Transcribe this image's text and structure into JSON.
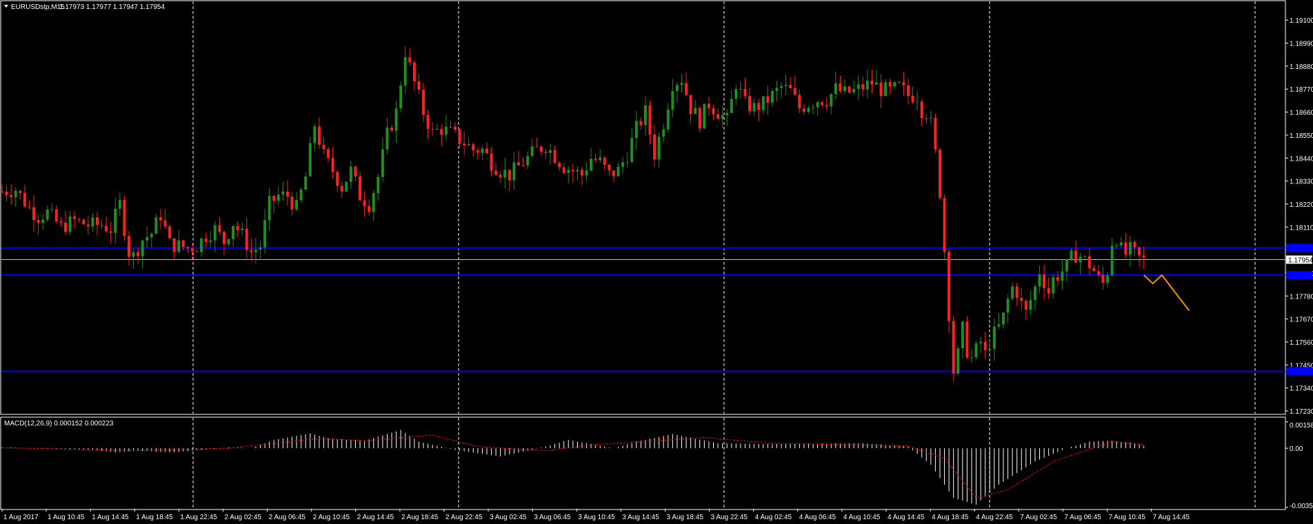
{
  "window": {
    "symbol_title": "EURUSDstp,M15",
    "ohlc": "1.17973 1.17977 1.17947 1.17954"
  },
  "colors": {
    "background": "#000000",
    "grid": "#ffffff",
    "bull_candle": "#1f8f1f",
    "bear_candle": "#ff2020",
    "level_line": "#0000ff",
    "bid_line": "#c0c0c0",
    "forecast_line": "#ff8c00",
    "macd_hist": "#ffffff",
    "macd_signal": "#ff0000"
  },
  "chart_data": [
    {
      "type": "candlestick",
      "title": "EURUSDstp,M15",
      "ylim": [
        1.1723,
        1.1917
      ],
      "y_ticks": [
        "1.19100",
        "1.18990",
        "1.18880",
        "1.18770",
        "1.18660",
        "1.18550",
        "1.18440",
        "1.18330",
        "1.18220",
        "1.18110",
        "1.17890",
        "1.17780",
        "1.17670",
        "1.17560",
        "1.17450",
        "1.17340",
        "1.17230"
      ],
      "x_ticks": [
        "1 Aug 2017",
        "1 Aug 10:45",
        "1 Aug 14:45",
        "1 Aug 18:45",
        "1 Aug 22:45",
        "2 Aug 02:45",
        "2 Aug 06:45",
        "2 Aug 10:45",
        "2 Aug 14:45",
        "2 Aug 18:45",
        "2 Aug 22:45",
        "3 Aug 02:45",
        "3 Aug 06:45",
        "3 Aug 10:45",
        "3 Aug 14:45",
        "3 Aug 18:45",
        "3 Aug 22:45",
        "4 Aug 02:45",
        "4 Aug 06:45",
        "4 Aug 10:45",
        "4 Aug 14:45",
        "4 Aug 18:45",
        "4 Aug 22:45",
        "7 Aug 02:45",
        "7 Aug 06:45",
        "7 Aug 10:45",
        "7 Aug 14:45"
      ],
      "current_price": "1.17954",
      "horizontal_levels": [
        1.1801,
        1.1788,
        1.1742
      ],
      "close_path": [
        [
          0,
          1.1828
        ],
        [
          3,
          1.1829
        ],
        [
          6,
          1.182
        ],
        [
          8,
          1.1816
        ],
        [
          10,
          1.1818
        ],
        [
          13,
          1.1811
        ],
        [
          16,
          1.1814
        ],
        [
          19,
          1.1812
        ],
        [
          22,
          1.1812
        ],
        [
          24,
          1.181
        ],
        [
          26,
          1.1822
        ],
        [
          28,
          1.1799
        ],
        [
          29,
          1.1797
        ],
        [
          31,
          1.1805
        ],
        [
          33,
          1.1808
        ],
        [
          35,
          1.1817
        ],
        [
          37,
          1.1803
        ],
        [
          39,
          1.1802
        ],
        [
          41,
          1.1801
        ],
        [
          43,
          1.1802
        ],
        [
          45,
          1.1807
        ],
        [
          47,
          1.181
        ],
        [
          49,
          1.1804
        ],
        [
          51,
          1.1813
        ],
        [
          53,
          1.1807
        ],
        [
          55,
          1.1799
        ],
        [
          57,
          1.1802
        ],
        [
          59,
          1.1822
        ],
        [
          61,
          1.1826
        ],
        [
          63,
          1.1826
        ],
        [
          65,
          1.182
        ],
        [
          67,
          1.1835
        ],
        [
          69,
          1.186
        ],
        [
          71,
          1.1845
        ],
        [
          73,
          1.1838
        ],
        [
          75,
          1.183
        ],
        [
          77,
          1.1838
        ],
        [
          79,
          1.1826
        ],
        [
          81,
          1.1822
        ],
        [
          83,
          1.1835
        ],
        [
          85,
          1.1855
        ],
        [
          87,
          1.1866
        ],
        [
          89,
          1.1895
        ],
        [
          91,
          1.188
        ],
        [
          93,
          1.1866
        ],
        [
          95,
          1.1856
        ],
        [
          97,
          1.1858
        ],
        [
          99,
          1.1856
        ],
        [
          101,
          1.1853
        ],
        [
          104,
          1.1848
        ],
        [
          106,
          1.1848
        ],
        [
          108,
          1.1842
        ],
        [
          110,
          1.1838
        ],
        [
          112,
          1.1836
        ],
        [
          114,
          1.184
        ],
        [
          116,
          1.1844
        ],
        [
          118,
          1.1848
        ],
        [
          120,
          1.185
        ],
        [
          122,
          1.1845
        ],
        [
          124,
          1.184
        ],
        [
          126,
          1.1838
        ],
        [
          128,
          1.1836
        ],
        [
          130,
          1.1844
        ],
        [
          132,
          1.1842
        ],
        [
          134,
          1.1836
        ],
        [
          136,
          1.1838
        ],
        [
          138,
          1.1846
        ],
        [
          140,
          1.1858
        ],
        [
          142,
          1.1866
        ],
        [
          144,
          1.1846
        ],
        [
          146,
          1.1861
        ],
        [
          148,
          1.188
        ],
        [
          150,
          1.1882
        ],
        [
          152,
          1.1868
        ],
        [
          154,
          1.1862
        ],
        [
          156,
          1.187
        ],
        [
          158,
          1.1866
        ],
        [
          160,
          1.1862
        ],
        [
          162,
          1.188
        ],
        [
          164,
          1.187
        ],
        [
          166,
          1.1868
        ],
        [
          168,
          1.187
        ],
        [
          170,
          1.1874
        ],
        [
          172,
          1.1878
        ],
        [
          174,
          1.1876
        ],
        [
          176,
          1.1868
        ],
        [
          178,
          1.187
        ],
        [
          180,
          1.1872
        ],
        [
          182,
          1.1872
        ],
        [
          184,
          1.1877
        ],
        [
          186,
          1.1875
        ],
        [
          188,
          1.1876
        ],
        [
          190,
          1.1878
        ],
        [
          192,
          1.188
        ],
        [
          194,
          1.1877
        ],
        [
          196,
          1.1876
        ],
        [
          198,
          1.1878
        ],
        [
          200,
          1.1874
        ],
        [
          202,
          1.1874
        ],
        [
          203,
          1.1867
        ],
        [
          204,
          1.1866
        ],
        [
          205,
          1.186
        ],
        [
          206,
          1.1846
        ],
        [
          207,
          1.1828
        ],
        [
          208,
          1.18
        ],
        [
          209,
          1.177
        ],
        [
          210,
          1.1742
        ],
        [
          211,
          1.175
        ],
        [
          212,
          1.1762
        ],
        [
          213,
          1.1752
        ],
        [
          214,
          1.1748
        ],
        [
          215,
          1.1752
        ],
        [
          216,
          1.1756
        ],
        [
          217,
          1.175
        ],
        [
          218,
          1.1756
        ],
        [
          219,
          1.176
        ],
        [
          220,
          1.1763
        ],
        [
          221,
          1.1768
        ],
        [
          222,
          1.1776
        ],
        [
          223,
          1.1782
        ],
        [
          224,
          1.178
        ],
        [
          225,
          1.1774
        ],
        [
          226,
          1.177
        ],
        [
          227,
          1.1776
        ],
        [
          228,
          1.1782
        ],
        [
          229,
          1.179
        ],
        [
          230,
          1.1785
        ],
        [
          231,
          1.178
        ],
        [
          232,
          1.1786
        ],
        [
          233,
          1.1788
        ],
        [
          234,
          1.179
        ],
        [
          235,
          1.1792
        ],
        [
          236,
          1.1796
        ],
        [
          237,
          1.1798
        ],
        [
          238,
          1.1797
        ],
        [
          239,
          1.1795
        ],
        [
          240,
          1.1793
        ],
        [
          241,
          1.179
        ],
        [
          242,
          1.1786
        ],
        [
          243,
          1.1784
        ],
        [
          244,
          1.179
        ],
        [
          245,
          1.1804
        ],
        [
          246,
          1.1806
        ],
        [
          247,
          1.18
        ],
        [
          248,
          1.1798
        ],
        [
          249,
          1.18
        ],
        [
          250,
          1.1798
        ],
        [
          251,
          1.1796
        ],
        [
          252,
          1.1795
        ]
      ],
      "forecast_path": [
        [
          252,
          1.1788
        ],
        [
          254,
          1.1784
        ],
        [
          256,
          1.1788
        ],
        [
          262,
          1.1771
        ]
      ]
    },
    {
      "type": "macd",
      "title": "MACD(12,26,9) 0.000152 0.000223",
      "ylim": [
        -0.00357,
        0.001584
      ],
      "y_ticks": [
        "0.001584",
        "0.00",
        "-0.00357"
      ],
      "hist_path": [
        [
          0,
          5e-05
        ],
        [
          20,
          -0.0001
        ],
        [
          25,
          -0.00025
        ],
        [
          30,
          -0.00015
        ],
        [
          38,
          -0.00025
        ],
        [
          45,
          -8e-05
        ],
        [
          50,
          5e-05
        ],
        [
          55,
          0.0
        ],
        [
          60,
          0.0005
        ],
        [
          68,
          0.0009
        ],
        [
          72,
          0.0006
        ],
        [
          80,
          0.00045
        ],
        [
          88,
          0.0011
        ],
        [
          92,
          0.0004
        ],
        [
          100,
          -0.0001
        ],
        [
          110,
          -0.0005
        ],
        [
          120,
          0.0001
        ],
        [
          125,
          0.0005
        ],
        [
          135,
          0.0
        ],
        [
          140,
          0.0004
        ],
        [
          148,
          0.00085
        ],
        [
          158,
          0.0003
        ],
        [
          170,
          0.00025
        ],
        [
          190,
          0.0003
        ],
        [
          200,
          0.0001
        ],
        [
          205,
          -0.001
        ],
        [
          210,
          -0.003
        ],
        [
          215,
          -0.0034
        ],
        [
          220,
          -0.0022
        ],
        [
          228,
          -0.0008
        ],
        [
          235,
          0.0
        ],
        [
          240,
          0.0004
        ],
        [
          245,
          0.00045
        ],
        [
          250,
          0.0003
        ],
        [
          252,
          0.00015
        ]
      ],
      "signal_path": [
        [
          0,
          3e-05
        ],
        [
          30,
          -0.00015
        ],
        [
          50,
          0.0
        ],
        [
          70,
          0.0006
        ],
        [
          80,
          0.00045
        ],
        [
          95,
          0.0008
        ],
        [
          105,
          0.0001
        ],
        [
          120,
          -0.00015
        ],
        [
          130,
          0.0002
        ],
        [
          155,
          0.00065
        ],
        [
          170,
          0.0003
        ],
        [
          200,
          0.00015
        ],
        [
          208,
          -0.0006
        ],
        [
          215,
          -0.003
        ],
        [
          222,
          -0.0025
        ],
        [
          232,
          -0.0008
        ],
        [
          245,
          0.0004
        ],
        [
          252,
          0.00022
        ]
      ]
    }
  ]
}
